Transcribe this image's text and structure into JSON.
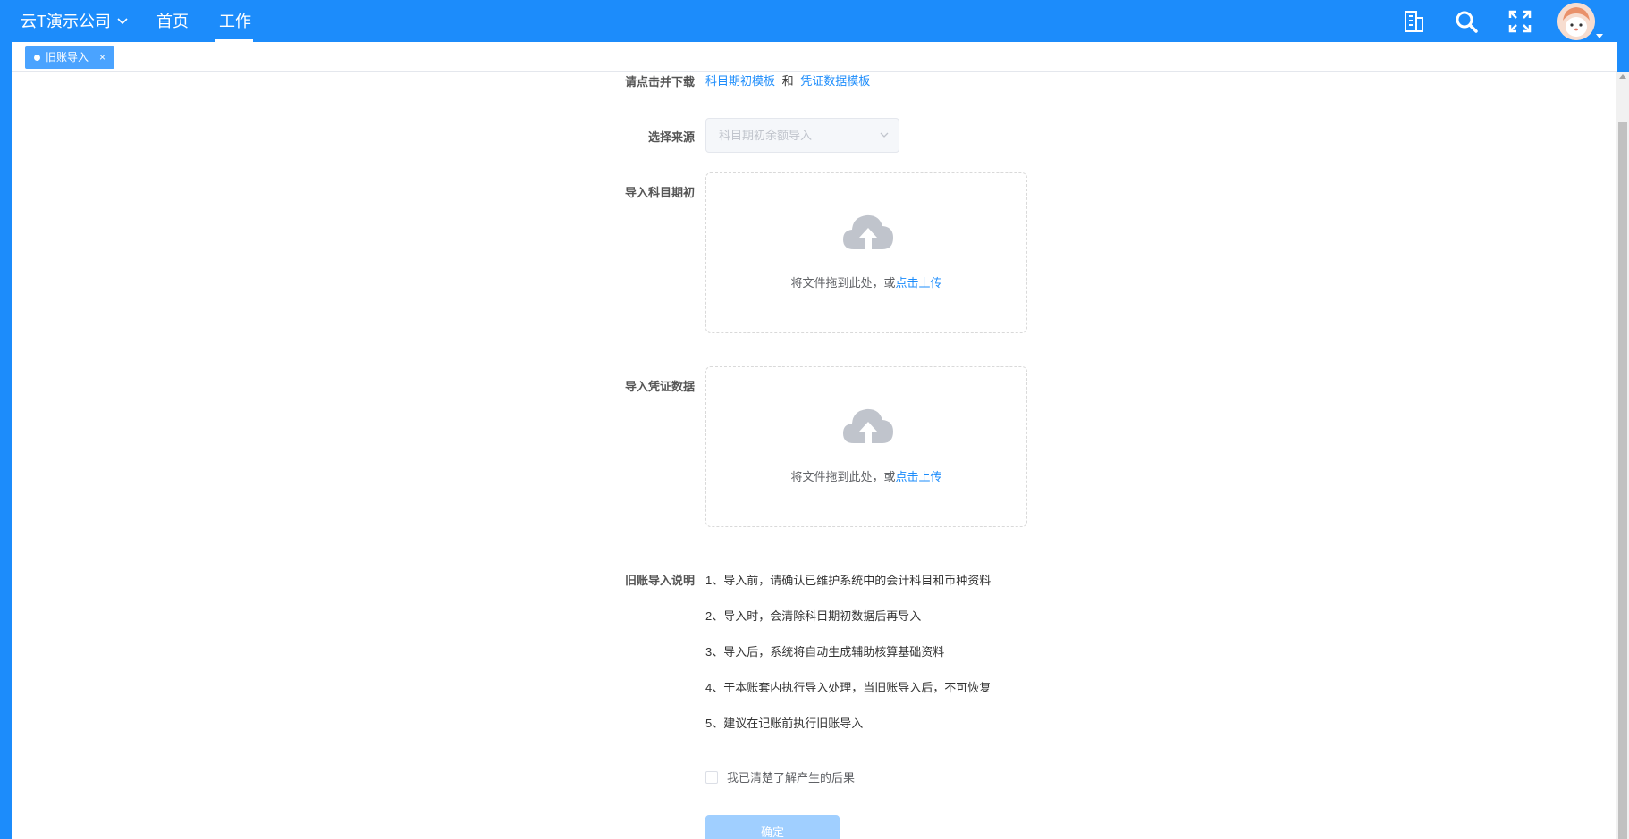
{
  "header": {
    "company": "云T演示公司",
    "nav": [
      {
        "label": "首页"
      },
      {
        "label": "工作"
      }
    ]
  },
  "tabs": [
    {
      "label": "旧账导入",
      "close": "×"
    }
  ],
  "form": {
    "download": {
      "label": "请点击并下载",
      "link1": "科目期初模板",
      "and": "和",
      "link2": "凭证数据模板"
    },
    "source": {
      "label": "选择来源",
      "value": "科目期初余额导入"
    },
    "upload_opening": {
      "label": "导入科目期初",
      "text": "将文件拖到此处，或",
      "link": "点击上传"
    },
    "upload_voucher": {
      "label": "导入凭证数据",
      "text": "将文件拖到此处，或",
      "link": "点击上传"
    },
    "instructions": {
      "label": "旧账导入说明",
      "items": [
        "1、导入前，请确认已维护系统中的会计科目和币种资料",
        "2、导入时，会清除科目期初数据后再导入",
        "3、导入后，系统将自动生成辅助核算基础资料",
        "4、于本账套内执行导入处理，当旧账导入后，不可恢复",
        "5、建议在记账前执行旧账导入"
      ]
    },
    "agree": "我已清楚了解产生的后果",
    "confirm": "确定"
  },
  "colors": {
    "brand": "#1c8cfb",
    "tab": "#4aa3ff",
    "button_disabled": "#a0cfff"
  }
}
